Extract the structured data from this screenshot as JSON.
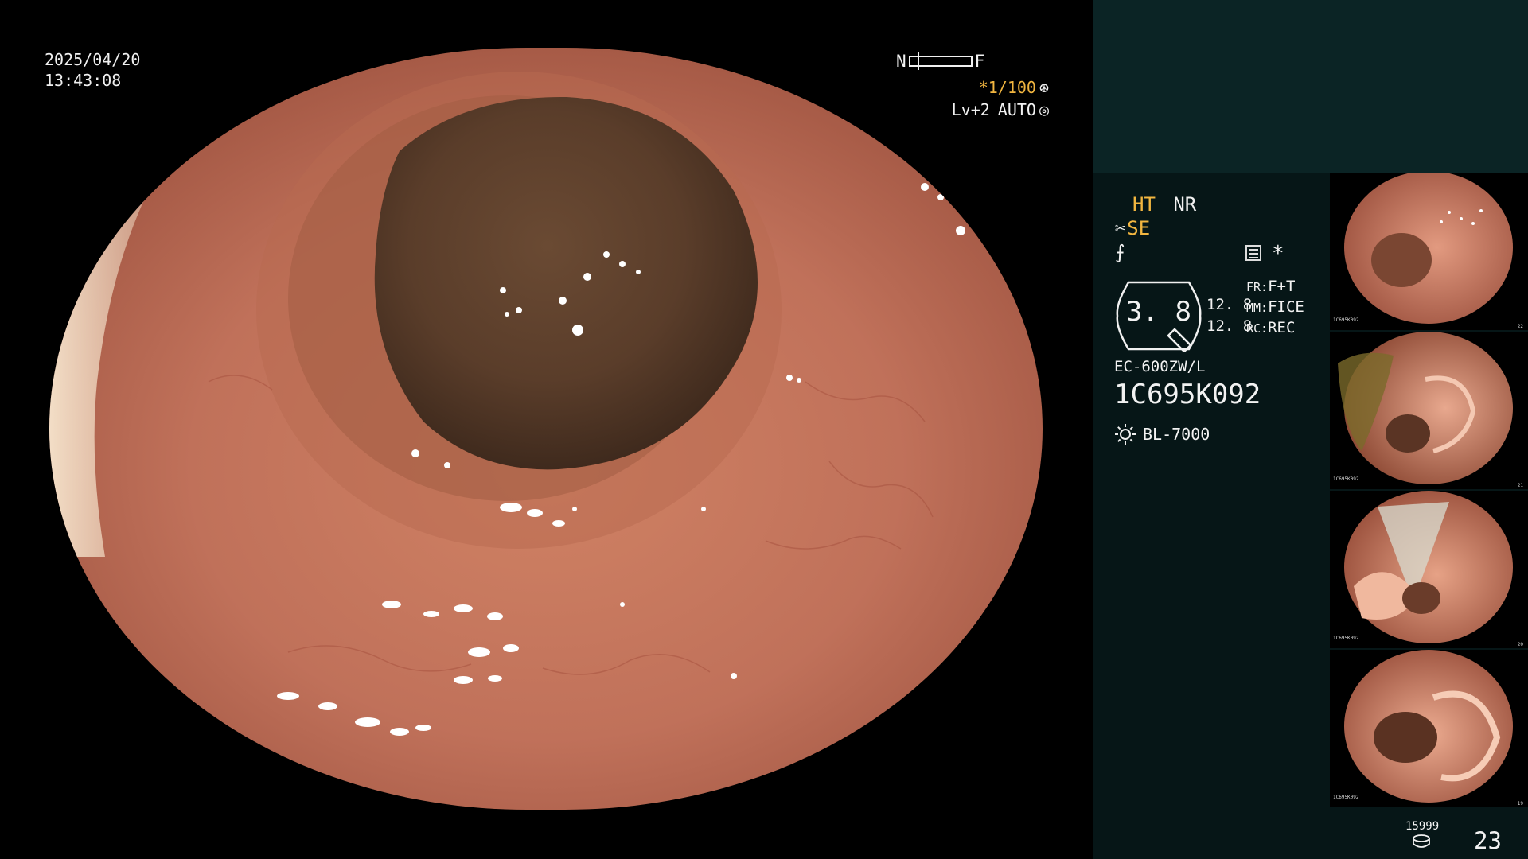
{
  "osd": {
    "date": "2025/04/20",
    "time": "13:43:08",
    "focus_near": "N",
    "focus_far": "F",
    "focus_level": 0.12,
    "shutter": "*1/100",
    "level": "Lv+2",
    "iris": "AUTO"
  },
  "panel": {
    "ht": "HT",
    "nr": "NR",
    "se": "SE",
    "zoom": "3. 8",
    "zoom_fr": "12. 8",
    "zoom_mm": "12. 8",
    "fr_key": "FR:",
    "fr_value": "F+T",
    "mm_key": "MM:",
    "mm_value": "FICE",
    "rc_key": "RC:",
    "rc_value": "REC",
    "scope_model": "EC-600ZW/L",
    "scope_serial": "1C695K092",
    "light_source": "BL-7000",
    "accent_color": "#f2b640",
    "panel_color": "#061617"
  },
  "thumbnails": [
    {
      "label": "1C695K092",
      "index": "22"
    },
    {
      "label": "1C695K092",
      "index": "21"
    },
    {
      "label": "1C695K092",
      "index": "20"
    },
    {
      "label": "1C695K092",
      "index": "19"
    }
  ],
  "storage": {
    "remaining": "15999",
    "image_count": "23"
  },
  "icons": [
    "focus-bar-icon",
    "shutter-icon",
    "iris-icon",
    "scissors-icon",
    "structure-icon",
    "menu-icon",
    "star-icon",
    "light-bulb-icon",
    "disk-icon"
  ]
}
